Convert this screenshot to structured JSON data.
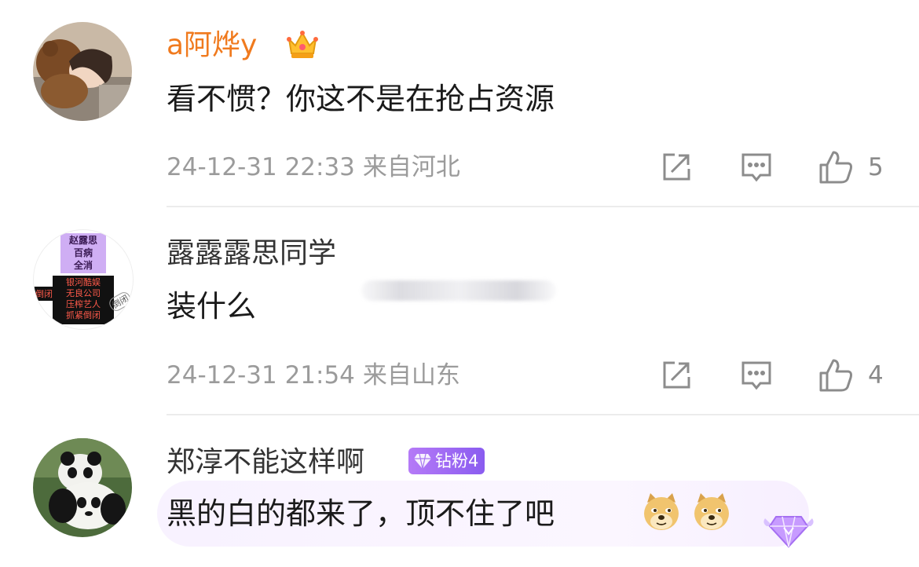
{
  "comments": [
    {
      "username": "a阿烨y",
      "text": "看不惯？你这不是在抢占资源",
      "time": "24-12-31 22:33",
      "location": "来自河北",
      "likes": "5"
    },
    {
      "username": "露露露思同学",
      "text": "装什么",
      "time": "24-12-31 21:54",
      "location": "来自山东",
      "likes": "4",
      "avatar_sign": {
        "top_lines": [
          "赵露思",
          "百病",
          "全消"
        ],
        "bottom_lines": [
          "银河酷娱",
          "无良公司",
          "压榨艺人",
          "抓紧倒闭"
        ],
        "side_left": "倒闭",
        "side_right": "倒闭"
      }
    },
    {
      "username": "郑淳不能这样啊",
      "badge": "钻粉4",
      "text": "黑的白的都来了，顶不住了吧"
    }
  ],
  "colors": {
    "vip_name": "#f07a1e",
    "meta": "#9b9b9b",
    "fan_badge": "#8a5cf0"
  },
  "icons": [
    "share-icon",
    "reply-icon",
    "like-icon",
    "crown-icon",
    "diamond-icon",
    "doge-emoji"
  ]
}
